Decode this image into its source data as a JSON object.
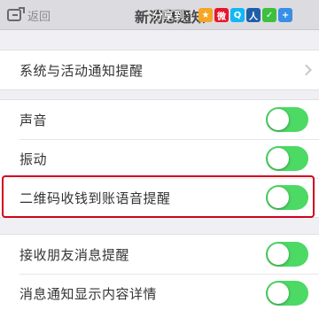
{
  "navbar": {
    "back_label": "返回",
    "title": "新消息通知",
    "share_label": "分享到：",
    "share_icons": [
      {
        "name": "qzone-icon",
        "color": "#f5a623",
        "glyph": "★"
      },
      {
        "name": "weibo-icon",
        "color": "#e6162d",
        "glyph": "微"
      },
      {
        "name": "qq-icon",
        "color": "#12b7f5",
        "glyph": "Q"
      },
      {
        "name": "renren-icon",
        "color": "#1f5fa8",
        "glyph": "人"
      },
      {
        "name": "wechat-icon",
        "color": "#3fbf3f",
        "glyph": "✓"
      },
      {
        "name": "more-share-icon",
        "color": "#3a8ee6",
        "glyph": "+"
      }
    ]
  },
  "sections": [
    {
      "rows": [
        {
          "label": "系统与活动通知提醒",
          "control": "chevron"
        }
      ]
    },
    {
      "rows": [
        {
          "label": "声音",
          "control": "toggle",
          "on": true
        },
        {
          "label": "振动",
          "control": "toggle",
          "on": true
        },
        {
          "label": "二维码收钱到账语音提醒",
          "control": "toggle",
          "on": true
        }
      ]
    },
    {
      "rows": [
        {
          "label": "接收朋友消息提醒",
          "control": "toggle",
          "on": true
        },
        {
          "label": "消息通知显示内容详情",
          "control": "toggle",
          "on": true
        }
      ]
    }
  ],
  "colors": {
    "toggle_on": "#4cd964",
    "highlight": "#d0021b",
    "background": "#efeff4"
  }
}
